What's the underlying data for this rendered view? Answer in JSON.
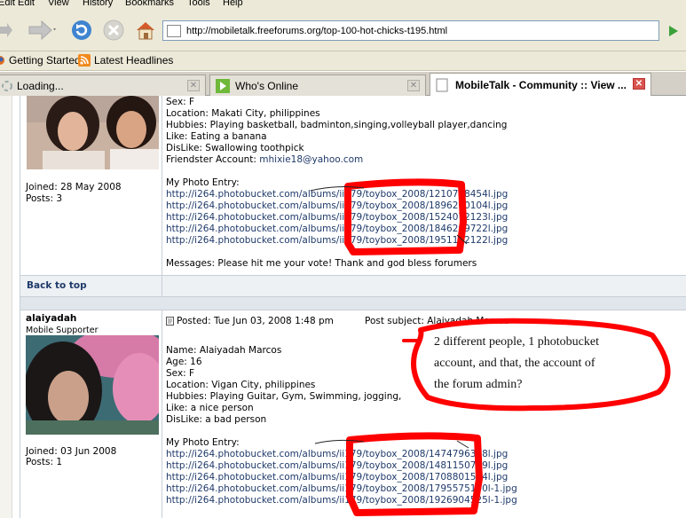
{
  "menu": [
    "Edit",
    "View",
    "History",
    "Bookmarks",
    "Tools",
    "Help"
  ],
  "address_bar": {
    "url": "http://mobiletalk.freeforums.org/top-100-hot-chicks-t195.html"
  },
  "bookmarks": [
    "Getting Started",
    "Latest Headlines"
  ],
  "tabs": [
    {
      "label": "Loading..."
    },
    {
      "label": "Who's Online"
    },
    {
      "label": "MobileTalk - Community :: View ..."
    }
  ],
  "post1": {
    "joined": "Joined: 28 May 2008",
    "posts": "Posts: 3",
    "lines": [
      "Sex: F",
      "Location: Makati City, philippines",
      "Hubbies: Playing basketball, badminton,singing,volleyball player,dancing",
      "Like: Eating a banana",
      "DisLike: Swallowing toothpick"
    ],
    "friendster_label": "Friendster Account: ",
    "friendster_email": "mhixie18@yahoo.com",
    "photo_entry": "My Photo Entry:",
    "links": [
      "http://i264.photobucket.com/albums/ii179/toybox_2008/1210798454l.jpg",
      "http://i264.photobucket.com/albums/ii179/toybox_2008/1896200104l.jpg",
      "http://i264.photobucket.com/albums/ii179/toybox_2008/1524072123l.jpg",
      "http://i264.photobucket.com/albums/ii179/toybox_2008/1846289722l.jpg",
      "http://i264.photobucket.com/albums/ii179/toybox_2008/1951142122l.jpg"
    ],
    "messages": "Messages: Please hit me your vote! Thank and god bless forumers"
  },
  "back_to_top": "Back to top",
  "post2": {
    "username": "alaiyadah",
    "rank": "Mobile Supporter",
    "posted": "Posted: Tue Jun 03, 2008 1:48 pm",
    "subject": "Post subject: Alaiyadah Marcos",
    "joined": "Joined: 03 Jun 2008",
    "posts": "Posts: 1",
    "lines": [
      "Name: Alaiyadah Marcos",
      "Age: 16",
      "Sex: F",
      "Location: Vigan City, philippines",
      "Hubbies: Playing Guitar, Gym, Swimming, jogging,",
      "Like: a nice person",
      "DisLike: a bad person"
    ],
    "photo_entry": "My Photo Entry:",
    "links": [
      "http://i264.photobucket.com/albums/ii179/toybox_2008/1474796388l.jpg",
      "http://i264.photobucket.com/albums/ii179/toybox_2008/1481150749l.jpg",
      "http://i264.photobucket.com/albums/ii179/toybox_2008/1708801544l.jpg",
      "http://i264.photobucket.com/albums/ii179/toybox_2008/1795575100l-1.jpg",
      "http://i264.photobucket.com/albums/ii179/toybox_2008/1926904525l-1.jpg"
    ]
  },
  "annotation": {
    "lines": [
      "2 different people, 1 photobucket",
      "account, and that, the account of",
      "the forum admin?"
    ],
    "color": "#ff0000"
  }
}
